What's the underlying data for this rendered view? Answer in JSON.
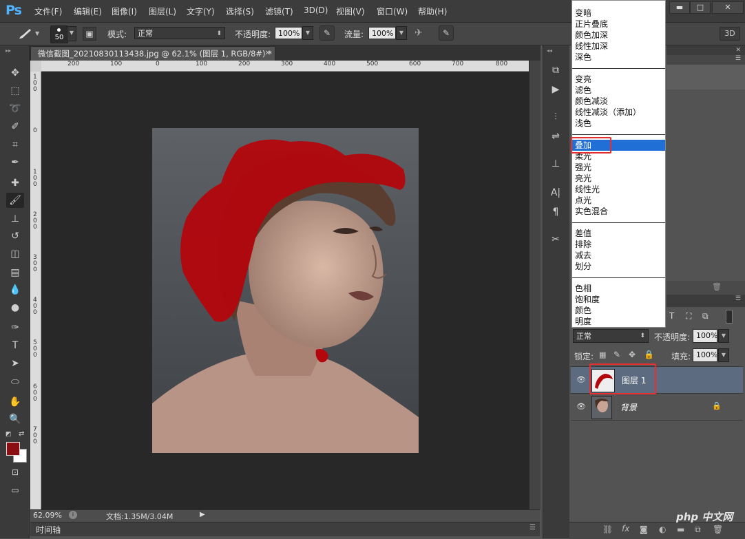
{
  "app": {
    "logo": "Ps"
  },
  "menu": [
    "文件(F)",
    "编辑(E)",
    "图像(I)",
    "图层(L)",
    "文字(Y)",
    "选择(S)",
    "滤镜(T)",
    "3D(D)",
    "视图(V)",
    "窗口(W)",
    "帮助(H)"
  ],
  "window": {
    "minimize": "▬",
    "maximize": "□",
    "close": "✕"
  },
  "options": {
    "brush_size": "50",
    "mode_label": "模式:",
    "mode_value": "正常",
    "opacity_label": "不透明度:",
    "opacity_value": "100%",
    "flow_label": "流量:",
    "flow_value": "100%",
    "btn_3d": "3D"
  },
  "document": {
    "tab_title": "微信截图_20210830113438.jpg @ 62.1% (图层 1, RGB/8#) *",
    "ruler_h": [
      "200",
      "100",
      "0",
      "100",
      "200",
      "300",
      "400",
      "500",
      "600",
      "700",
      "800"
    ],
    "ruler_v": [
      "1\n0\n0",
      "0",
      "1\n0\n0",
      "2\n0\n0",
      "3\n0\n0",
      "4\n0\n0",
      "5\n0\n0",
      "6\n0\n0",
      "7\n0\n0"
    ]
  },
  "status": {
    "zoom": "62.09%",
    "doc_info": "文档:1.35M/3.04M"
  },
  "timeline": {
    "label": "时间轴"
  },
  "blend_modes": {
    "groups": [
      [
        "变暗",
        "正片叠底",
        "颜色加深",
        "线性加深",
        "深色"
      ],
      [
        "变亮",
        "滤色",
        "颜色减淡",
        "线性减淡（添加）",
        "浅色"
      ],
      [
        "叠加",
        "柔光",
        "强光",
        "亮光",
        "线性光",
        "点光",
        "实色混合"
      ],
      [
        "差值",
        "排除",
        "减去",
        "划分"
      ],
      [
        "色相",
        "饱和度",
        "颜色",
        "明度"
      ]
    ],
    "selected": "叠加"
  },
  "layers_panel": {
    "blend_value": "正常",
    "opacity_label": "不透明度:",
    "opacity_value": "100%",
    "lock_label": "锁定:",
    "fill_label": "填充:",
    "fill_value": "100%",
    "layers": [
      {
        "name": "图层 1"
      },
      {
        "name": "背景"
      }
    ]
  },
  "watermark": "php 中文网",
  "colors": {
    "foreground": "#8b0f12",
    "background": "#ffffff",
    "selection": "#1f6fd6",
    "highlight_box": "#e53030"
  }
}
